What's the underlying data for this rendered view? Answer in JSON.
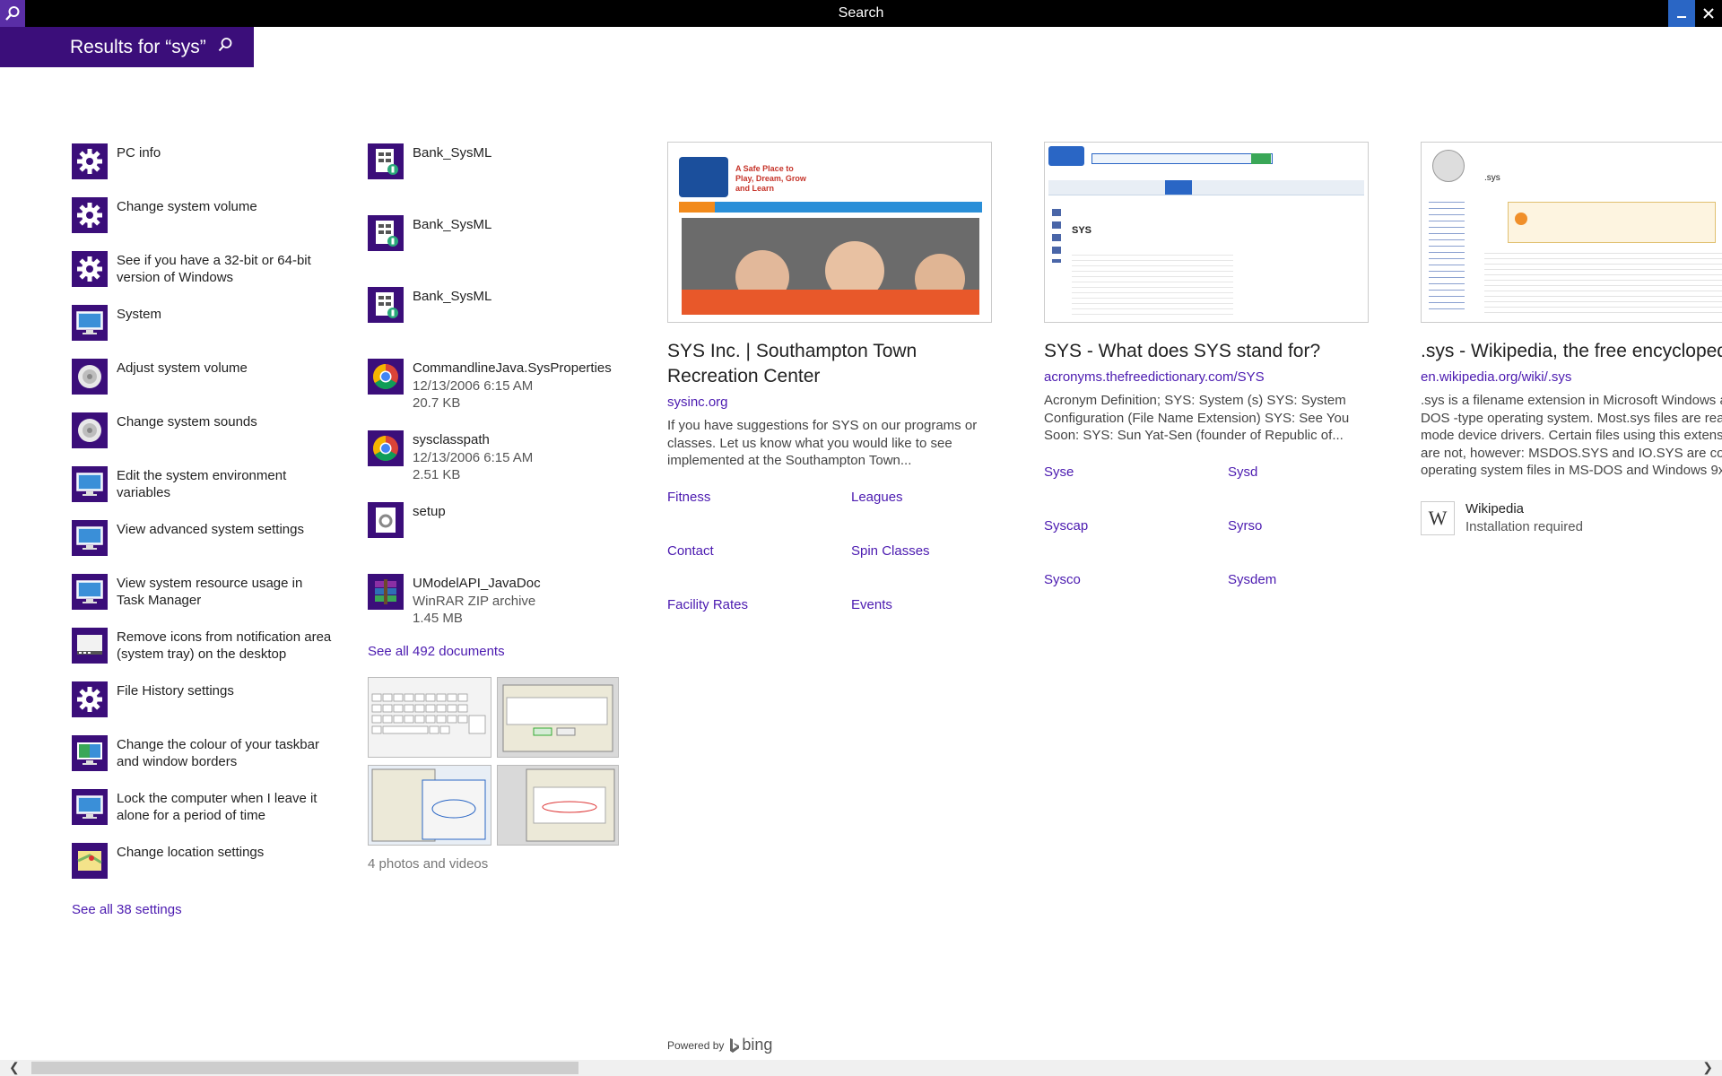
{
  "window": {
    "title": "Search"
  },
  "header": {
    "results_text": "Results for “sys”"
  },
  "settings": {
    "items": [
      {
        "label": "PC info",
        "icon": "gear-icon"
      },
      {
        "label": "Change system volume",
        "icon": "gear-icon"
      },
      {
        "label": "See if you have a 32-bit or 64-bit version of Windows",
        "icon": "gear-icon"
      },
      {
        "label": "System",
        "icon": "monitor-icon"
      },
      {
        "label": "Adjust system volume",
        "icon": "speaker-icon"
      },
      {
        "label": "Change system sounds",
        "icon": "speaker-icon"
      },
      {
        "label": "Edit the system environment variables",
        "icon": "monitor-icon"
      },
      {
        "label": "View advanced system settings",
        "icon": "monitor-icon"
      },
      {
        "label": "View system resource usage in Task Manager",
        "icon": "monitor-icon"
      },
      {
        "label": "Remove icons from notification area (system tray) on the desktop",
        "icon": "taskbar-icon"
      },
      {
        "label": "File History settings",
        "icon": "gear-icon"
      },
      {
        "label": "Change the colour of your taskbar and window borders",
        "icon": "monitor-color-icon"
      },
      {
        "label": "Lock the computer when I leave it alone for a period of time",
        "icon": "monitor-icon"
      },
      {
        "label": "Change location settings",
        "icon": "location-icon"
      }
    ],
    "see_all": "See all 38 settings"
  },
  "documents": {
    "items": [
      {
        "name": "Bank_SysML",
        "line2": "",
        "line3": "",
        "icon": "document-icon"
      },
      {
        "name": "Bank_SysML",
        "line2": "",
        "line3": "",
        "icon": "document-icon"
      },
      {
        "name": "Bank_SysML",
        "line2": "",
        "line3": "",
        "icon": "document-icon"
      },
      {
        "name": "CommandlineJava.SysProperties",
        "line2": "12/13/2006 6:15 AM",
        "line3": "20.7 KB",
        "icon": "chrome-icon"
      },
      {
        "name": "sysclasspath",
        "line2": "12/13/2006 6:15 AM",
        "line3": "2.51 KB",
        "icon": "chrome-icon"
      },
      {
        "name": "setup",
        "line2": "",
        "line3": "",
        "icon": "setup-file-icon"
      },
      {
        "name": "UModelAPI_JavaDoc",
        "line2": "WinRAR ZIP archive",
        "line3": "1.45 MB",
        "icon": "winrar-icon"
      }
    ],
    "see_all": "See all 492 documents",
    "photos_label": "4 photos and videos"
  },
  "web": [
    {
      "title": "SYS Inc. | Southampton Town Recreation Center",
      "url": "sysinc.org",
      "desc": "If you have suggestions for SYS on our programs or classes. Let us know what you would like to see implemented at the Southampton Town...",
      "thumb_text": "A Safe Place to Play, Dream, Grow and Learn",
      "links": [
        "Fitness",
        "Leagues",
        "Contact",
        "Spin Classes",
        "Facility Rates",
        "Events"
      ]
    },
    {
      "title": "SYS - What does SYS stand for?",
      "url": "acronyms.thefreedictionary.com/SYS",
      "desc": "Acronym Definition; SYS: System (s) SYS: System Configuration (File Name Extension) SYS: See You Soon: SYS: Sun Yat-Sen (founder of Republic of...",
      "thumb_text": "SYS",
      "links": [
        "Syse",
        "Sysd",
        "Syscap",
        "Syrso",
        "Sysco",
        "Sysdem"
      ]
    },
    {
      "title": ".sys - Wikipedia, the free encyclopedia",
      "url": "en.wikipedia.org/wiki/.sys",
      "desc": ".sys is a filename extension in Microsoft Windows and DOS -type operating system. Most.sys files are real mode device drivers. Certain files using this extension are not, however: MSDOS.SYS and IO.SYS are core operating system files in MS-DOS and Windows 9x...",
      "thumb_text": ".sys",
      "app_name": "Wikipedia",
      "app_status": "Installation required"
    }
  ],
  "footer": {
    "powered_by": "Powered by",
    "brand": "bing"
  },
  "colors": {
    "accent": "#3b0e7a",
    "link": "#4b1ab0",
    "titlebar": "#000000"
  }
}
